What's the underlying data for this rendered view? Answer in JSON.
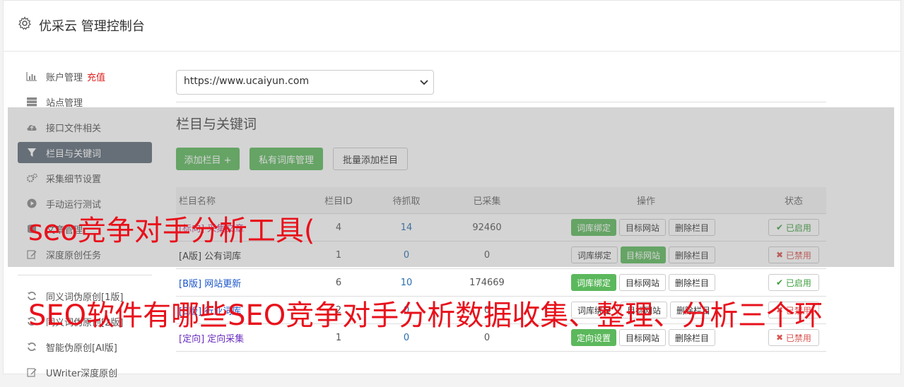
{
  "header": {
    "title": "优采云 管理控制台",
    "icon": "gear-icon"
  },
  "sidebar": {
    "items": [
      {
        "label": "账户管理",
        "extra": "充值",
        "icon": "bar-chart-icon"
      },
      {
        "label": "站点管理",
        "icon": "server-icon"
      },
      {
        "label": "接口文件相关",
        "icon": "cloud-upload-icon"
      },
      {
        "label": "栏目与关键词",
        "icon": "filter-icon",
        "active": true
      },
      {
        "label": "采集细节设置",
        "icon": "cogs-icon"
      },
      {
        "label": "手动运行测试",
        "icon": "play-circle-icon"
      },
      {
        "label": "文章管理",
        "icon": "database-icon"
      },
      {
        "label": "深度原创任务",
        "icon": "edit-icon"
      }
    ],
    "items2": [
      {
        "label": "同义词伪原创[1版]",
        "icon": "refresh-icon"
      },
      {
        "label": "同义词伪原创[2版]",
        "icon": "refresh-icon"
      },
      {
        "label": "智能伪原创[AI版]",
        "icon": "refresh-icon"
      },
      {
        "label": "UWriter深度原创",
        "icon": "edit-icon"
      }
    ]
  },
  "main": {
    "site_select": "https://www.ucaiyun.com",
    "section_title": "栏目与关键词",
    "buttons": {
      "add": "添加栏目 +",
      "private": "私有词库管理",
      "batch": "批量添加栏目"
    },
    "table": {
      "headers": [
        "栏目名称",
        "栏目ID",
        "待抓取",
        "已采集",
        "操作",
        "状态"
      ],
      "rows": [
        {
          "name": "[标向] 采集文章",
          "id": "4",
          "pending": "14",
          "collected": "92460",
          "op1": "词库绑定",
          "op2": "目标网站",
          "op3": "删除栏目",
          "status": "已启用"
        },
        {
          "name": "[A版] 公有词库",
          "id": "1",
          "pending": "0",
          "collected": "0",
          "op1": "词库绑定",
          "op2": "目标网站",
          "op3": "删除栏目",
          "status": "已禁用"
        },
        {
          "name": "[B版] 网站更新",
          "id": "6",
          "pending": "10",
          "collected": "174669",
          "op1": "词库绑定",
          "op2": "目标网站",
          "op3": "删除栏目",
          "status": "已启用"
        },
        {
          "name": "[B版] 行业词库",
          "id": "2",
          "pending": "0",
          "collected": "0",
          "op1": "词库绑定",
          "op2": "目标网站",
          "op3": "删除栏目",
          "status": "已禁用"
        },
        {
          "name": "[定向] 定向采集",
          "id": "1",
          "pending": "0",
          "collected": "0",
          "op1": "定向设置",
          "op2": "目标网站",
          "op3": "删除栏目",
          "status": "已禁用"
        }
      ]
    }
  },
  "overlay_text": {
    "line1": "seo竞争对手分析工具(",
    "line2": "SEO软件有哪些SEO竞争对手分析数据收集、整理、分析三个环"
  },
  "colors": {
    "accent_green": "#5cb85c",
    "active_sidebar": "#5d6b78",
    "overlay_red": "#e8111b"
  }
}
